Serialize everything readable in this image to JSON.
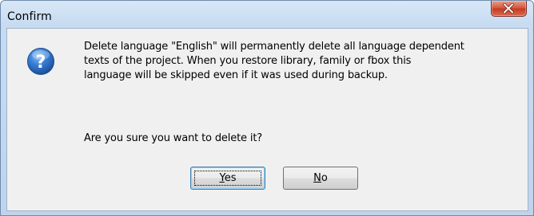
{
  "window": {
    "title": "Confirm",
    "close_icon": "close-icon"
  },
  "dialog": {
    "icon": "question-icon",
    "message_lines": [
      "Delete language \"English\" will permanently delete all language dependent",
      "texts of the project. When you restore library, family or fbox this",
      "language will be skipped even if it was used during backup."
    ],
    "question": "Are you sure you want to delete it?"
  },
  "buttons": {
    "yes": {
      "mnemonic": "Y",
      "rest": "es"
    },
    "no": {
      "mnemonic": "N",
      "rest": "o"
    }
  },
  "colors": {
    "frame": "#c7dbf1",
    "client_bg": "#f0f0f0",
    "close_button": "#c23a22",
    "icon_blue": "#1d63c2"
  }
}
